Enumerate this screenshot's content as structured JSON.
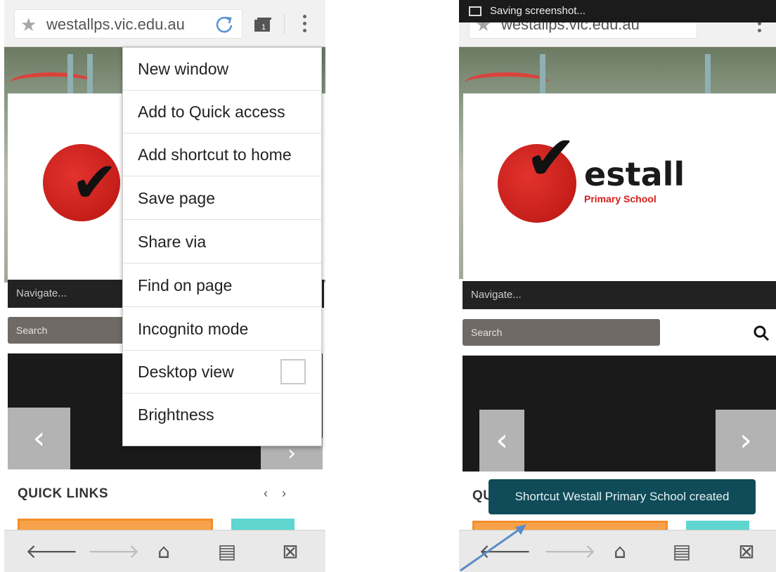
{
  "left_screen": {
    "address_bar": {
      "url": "westallps.vic.edu.au",
      "tab_count": "1"
    },
    "menu": {
      "items": [
        {
          "label": "New window"
        },
        {
          "label": "Add to Quick access"
        },
        {
          "label": "Add shortcut to home"
        },
        {
          "label": "Save page"
        },
        {
          "label": "Share via"
        },
        {
          "label": "Find on page"
        },
        {
          "label": "Incognito mode"
        },
        {
          "label": "Desktop view"
        },
        {
          "label": "Brightness"
        }
      ]
    },
    "page": {
      "navigate_label": "Navigate...",
      "search_placeholder": "Search",
      "quick_links_label": "QUICK LINKS",
      "quick_links_prev": "‹",
      "quick_links_next": "›"
    }
  },
  "right_screen": {
    "status_bar": {
      "text": "Saving screenshot..."
    },
    "address_bar": {
      "url": "westallps.vic.edu.au"
    },
    "page": {
      "logo_text": "estall",
      "logo_subtext": "Primary School",
      "navigate_label": "Navigate...",
      "search_placeholder": "Search",
      "quick_links_label": "QU"
    },
    "toast": {
      "text": "Shortcut Westall Primary School created"
    }
  },
  "colors": {
    "toast_bg": "#0f4b58",
    "logo_red": "#d21f1b",
    "search_bg": "#6f6a65",
    "navbar_bg": "#222222",
    "tile_orange": "#f7a24a",
    "tile_teal": "#5fd6d0",
    "annotation_arrow": "#5b8cc8"
  },
  "icons": [
    "star-icon",
    "reload-icon",
    "tabs-icon",
    "more-vert-icon",
    "back-icon",
    "forward-icon",
    "home-icon",
    "bookmarks-list-icon",
    "bookmark-icon",
    "search-icon",
    "image-icon"
  ]
}
